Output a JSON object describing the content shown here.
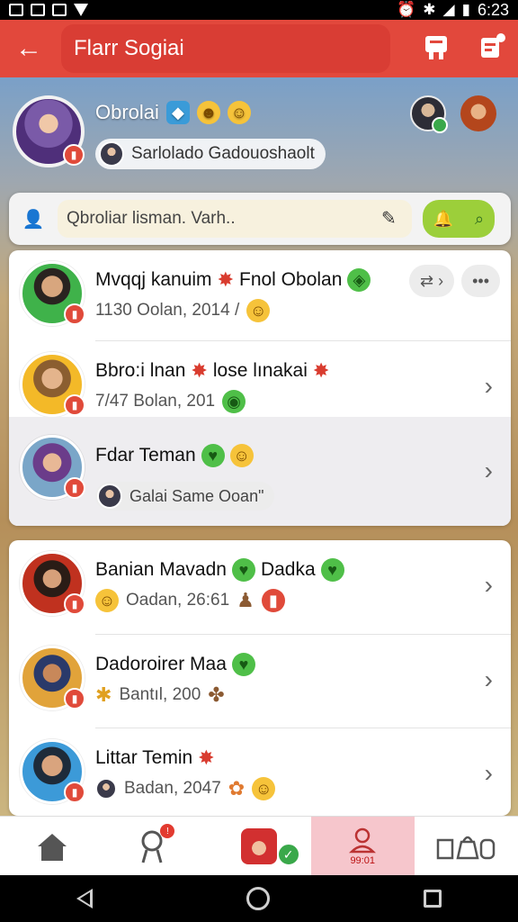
{
  "status_bar": {
    "time": "6:23"
  },
  "app_bar": {
    "title": "Flarr Sogiai"
  },
  "profile": {
    "name": "Obrolai",
    "chip_text": "Sarlolado Gadouoshaolt"
  },
  "search": {
    "placeholder": "Qbroliar lisman. Varh.."
  },
  "chats": [
    {
      "name": "Mvqqj kanuim",
      "name_extra": "Fnol Obolan",
      "subtitle": "1130 Oolan, 2014 /"
    },
    {
      "name": "Bbro:i lnan",
      "name_extra": "lose lınakai",
      "subtitle": "7/47 Bolan, 201"
    },
    {
      "name": "Fdar Teman",
      "name_extra": "",
      "subtitle": "Galai Same Ooan\""
    },
    {
      "name": "Banian Mavadn",
      "name_extra": "Dadka",
      "subtitle": "Oadan, 26:61"
    },
    {
      "name": "Dadoroirer Maa",
      "name_extra": "",
      "subtitle": "Bantıl, 200"
    },
    {
      "name": "Littar Temin",
      "name_extra": "",
      "subtitle": "Badan, 2047"
    }
  ],
  "bottom_nav": {
    "active_label": "99:01"
  },
  "colors": {
    "accent": "#e2483c",
    "active_tab": "#f6c6cc",
    "search_action": "#9ccf3a"
  },
  "icons": [
    "back-arrow-icon",
    "bookmark-icon",
    "compose-icon",
    "contacts-icon",
    "sticker-icon",
    "bell-icon",
    "search-icon",
    "home-icon",
    "pin-icon",
    "profile-icon",
    "bag-icon",
    "chevron-right-icon"
  ]
}
